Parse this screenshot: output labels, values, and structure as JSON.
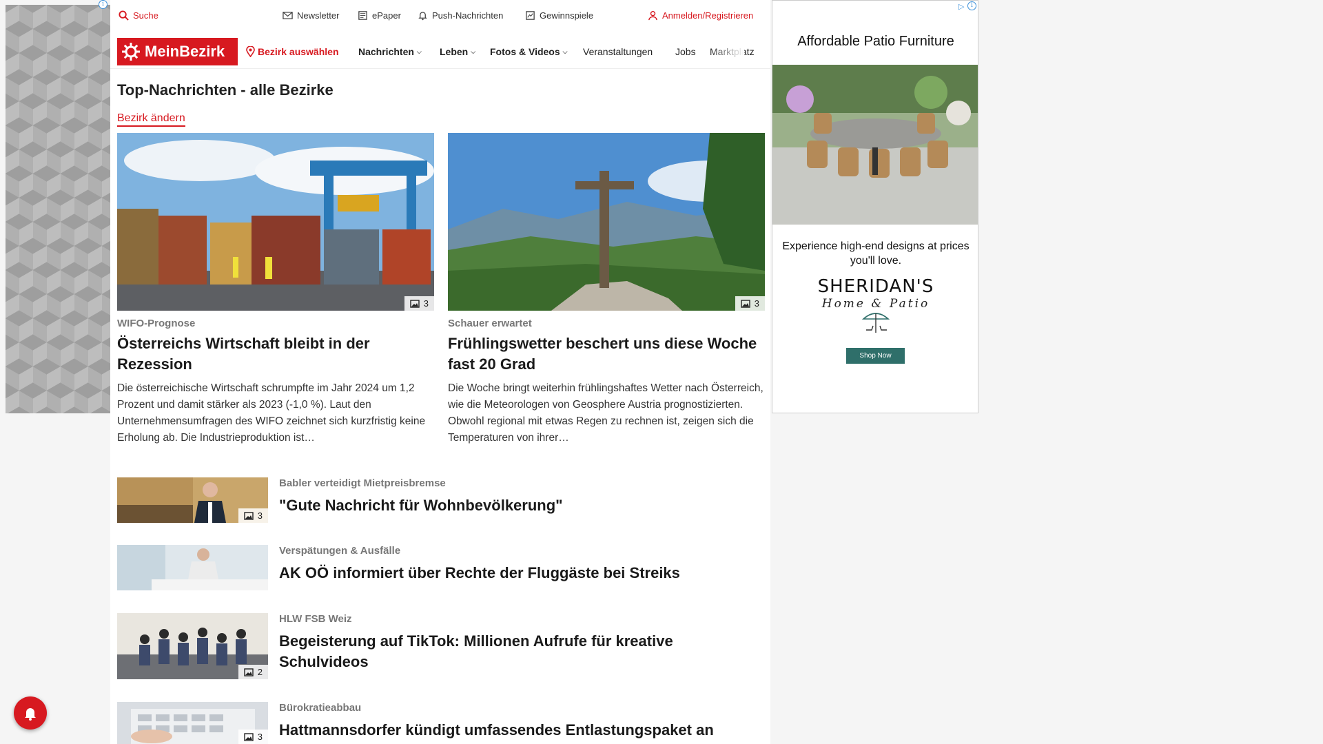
{
  "utilbar": {
    "search": "Suche",
    "newsletter": "Newsletter",
    "epaper": "ePaper",
    "push": "Push-Nachrichten",
    "gewinnspiele": "Gewinnspiele",
    "login": "Anmelden/Registrieren"
  },
  "nav": {
    "logo": "MeinBezirk",
    "bezirk": "Bezirk auswählen",
    "items": [
      "Nachrichten",
      "Leben",
      "Fotos & Videos",
      "Veranstaltungen",
      "Jobs",
      "Marktplatz"
    ]
  },
  "page": {
    "title": "Top-Nachrichten - alle Bezirke",
    "change_link": "Bezirk ändern"
  },
  "features": [
    {
      "kicker": "WIFO-Prognose",
      "headline": "Österreichs Wirtschaft bleibt in der Rezession",
      "teaser": "Die österreichische Wirtschaft schrumpfte im Jahr 2024 um 1,2 Prozent und damit stärker als 2023 (-1,0 %). Laut den Unternehmensumfragen des WIFO zeichnet sich kurzfristig keine Erholung ab. Die Industrieproduktion ist…",
      "image_count": "3"
    },
    {
      "kicker": "Schauer erwartet",
      "headline": "Frühlingswetter beschert uns diese Woche fast 20 Grad",
      "teaser": "Die Woche bringt weiterhin frühlingshaftes Wetter nach Österreich, wie die Meteorologen von Geosphere Austria prognostizierten. Obwohl regional mit etwas Regen zu rechnen ist, zeigen sich die Temperaturen von ihrer…",
      "image_count": "3"
    }
  ],
  "list": [
    {
      "kicker": "Babler verteidigt Mietpreisbremse",
      "headline": "\"Gute Nachricht für Wohnbevölkerung\"",
      "image_count": "3"
    },
    {
      "kicker": "Verspätungen & Ausfälle",
      "headline": "AK OÖ informiert über Rechte der Fluggäste bei Streiks",
      "image_count": ""
    },
    {
      "kicker": "HLW FSB Weiz",
      "headline": "Begeisterung auf TikTok: Millionen Aufrufe für kreative Schulvideos",
      "image_count": "2"
    },
    {
      "kicker": "Bürokratieabbau",
      "headline": "Hattmannsdorfer kündigt umfassendes Entlastungspaket an",
      "image_count": "3"
    }
  ],
  "ad": {
    "title": "Affordable Patio Furniture",
    "text": "Experience high-end designs at prices you'll love.",
    "brand": "SHERIDAN'S",
    "sub": "Home & Patio",
    "button": "Shop Now",
    "info": "i"
  },
  "colors": {
    "brand": "#d71920",
    "ad_button": "#2f6f6a"
  },
  "icons": [
    "search-icon",
    "mail-icon",
    "epaper-icon",
    "bell-icon",
    "gift-icon",
    "user-icon",
    "location-pin-icon",
    "gallery-icon"
  ]
}
